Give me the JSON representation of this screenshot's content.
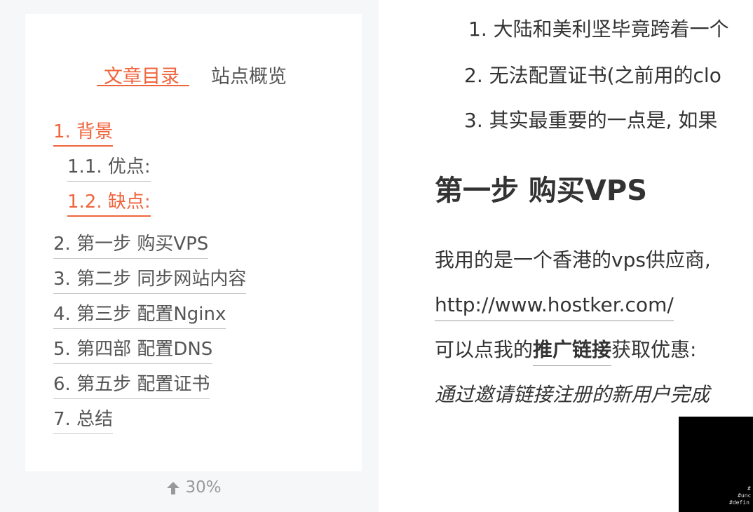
{
  "sidebar": {
    "tabs": {
      "toc": "文章目录",
      "overview": "站点概览"
    },
    "toc": [
      {
        "label": "1. 背景"
      },
      {
        "label": "1.1. 优点:"
      },
      {
        "label": "1.2. 缺点:"
      },
      {
        "label": "2. 第一步 购买VPS"
      },
      {
        "label": "3. 第二步 同步网站内容"
      },
      {
        "label": "4. 第三步 配置Nginx"
      },
      {
        "label": "5. 第四部 配置DNS"
      },
      {
        "label": "6. 第五步 配置证书"
      },
      {
        "label": "7. 总结"
      }
    ],
    "progress": "30%"
  },
  "article": {
    "list": [
      "1. 大陆和美利坚毕竟跨着一个",
      "2. 无法配置证书(之前用的clo",
      "3. 其实最重要的一点是, 如果"
    ],
    "heading": "第一步 购买VPS",
    "para1": "我用的是一个香港的vps供应商,",
    "url": "http://www.hostker.com/",
    "para3_prefix": "可以点我的",
    "promo_link": "推广链接",
    "para3_suffix": "获取优惠:",
    "para4": "通过邀请链接注册的新用户完成",
    "image_text": [
      "#",
      "#unc",
      "#defin"
    ]
  },
  "colors": {
    "accent": "#f0643c",
    "text": "#333333",
    "muted": "#555555",
    "sidebar_bg": "#f5f7f9"
  }
}
